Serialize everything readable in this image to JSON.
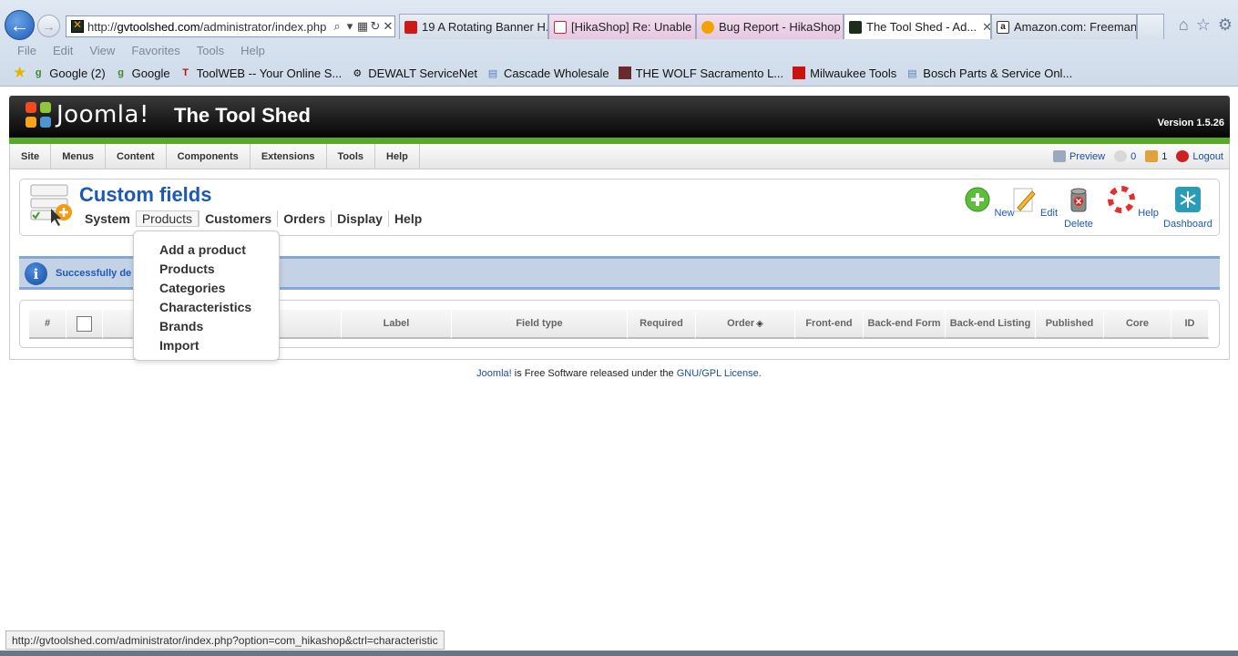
{
  "browser": {
    "address": {
      "prefix": "http://",
      "domain": "gvtoolshed.com",
      "path": "/administrator/index.php"
    },
    "tabs": [
      {
        "label": "19 A Rotating Banner H...",
        "icon": "youtube-icon",
        "color": "#cc1a1a",
        "active": false
      },
      {
        "label": "[HikaShop] Re: Unable t...",
        "icon": "gmail-icon",
        "color": "#c62828",
        "active": false
      },
      {
        "label": "Bug Report - HikaShop",
        "icon": "hikashop-icon",
        "color": "#f0a400",
        "active": false
      },
      {
        "label": "The Tool Shed - Ad...",
        "icon": "joomla-icon",
        "color": "#1c2d1c",
        "active": true
      },
      {
        "label": "Amazon.com: Freeman...",
        "icon": "amazon-icon",
        "color": "#333333",
        "active": false
      }
    ],
    "menu": [
      "File",
      "Edit",
      "View",
      "Favorites",
      "Tools",
      "Help"
    ],
    "favorites": [
      {
        "label": "Google (2)",
        "icon": "google-icon",
        "color": "#3a8a2a"
      },
      {
        "label": "Google",
        "icon": "google-icon",
        "color": "#3a8a2a"
      },
      {
        "label": "ToolWEB -- Your Online S...",
        "icon": "toolweb-icon",
        "color": "#b01818"
      },
      {
        "label": "DEWALT ServiceNet",
        "icon": "gear-icon",
        "color": "#111111"
      },
      {
        "label": "Cascade Wholesale",
        "icon": "page-icon",
        "color": "#5a7fb8"
      },
      {
        "label": "THE WOLF  Sacramento  L...",
        "icon": "wolf-icon",
        "color": "#6b2a2a"
      },
      {
        "label": "Milwaukee Tools",
        "icon": "milwaukee-icon",
        "color": "#cc1111"
      },
      {
        "label": "Bosch Parts & Service Onl...",
        "icon": "page-icon",
        "color": "#5a7fb8"
      }
    ],
    "status_url": "http://gvtoolshed.com/administrator/index.php?option=com_hikashop&ctrl=characteristic"
  },
  "joomla": {
    "logo_text": "Joomla!",
    "site_title": "The Tool Shed",
    "version": "Version 1.5.26",
    "admin_menu": [
      "Site",
      "Menus",
      "Content",
      "Components",
      "Extensions",
      "Tools",
      "Help"
    ],
    "header_right": {
      "preview": "Preview",
      "messages": "0",
      "users": "1",
      "logout": "Logout"
    }
  },
  "page": {
    "title": "Custom fields",
    "subnav": [
      "System",
      "Products",
      "Customers",
      "Orders",
      "Display",
      "Help"
    ],
    "subnav_active": "Products",
    "toolbar": [
      {
        "label": "New",
        "icon": "new-icon"
      },
      {
        "label": "Edit",
        "icon": "edit-icon"
      },
      {
        "label": "Delete",
        "icon": "delete-icon"
      },
      {
        "label": "Help",
        "icon": "help-icon"
      },
      {
        "label": "Dashboard",
        "icon": "dashboard-icon"
      }
    ],
    "message": "Successfully de",
    "dropdown": [
      "Add a product",
      "Products",
      "Categories",
      "Characteristics",
      "Brands",
      "Import"
    ],
    "table_headers": [
      "#",
      "",
      "",
      "Label",
      "Field type",
      "Required",
      "Order",
      "Front-end",
      "Back-end Form",
      "Back-end Listing",
      "Published",
      "Core",
      "ID"
    ]
  },
  "footer": {
    "joomla_link": "Joomla!",
    "text": " is Free Software released under the ",
    "license_link": "GNU/GPL License."
  },
  "colors": {
    "accent": "#1c58b5",
    "header_dark": "#050505",
    "green_bar": "#5aaa2a",
    "message_bg": "#c3d2e5"
  }
}
